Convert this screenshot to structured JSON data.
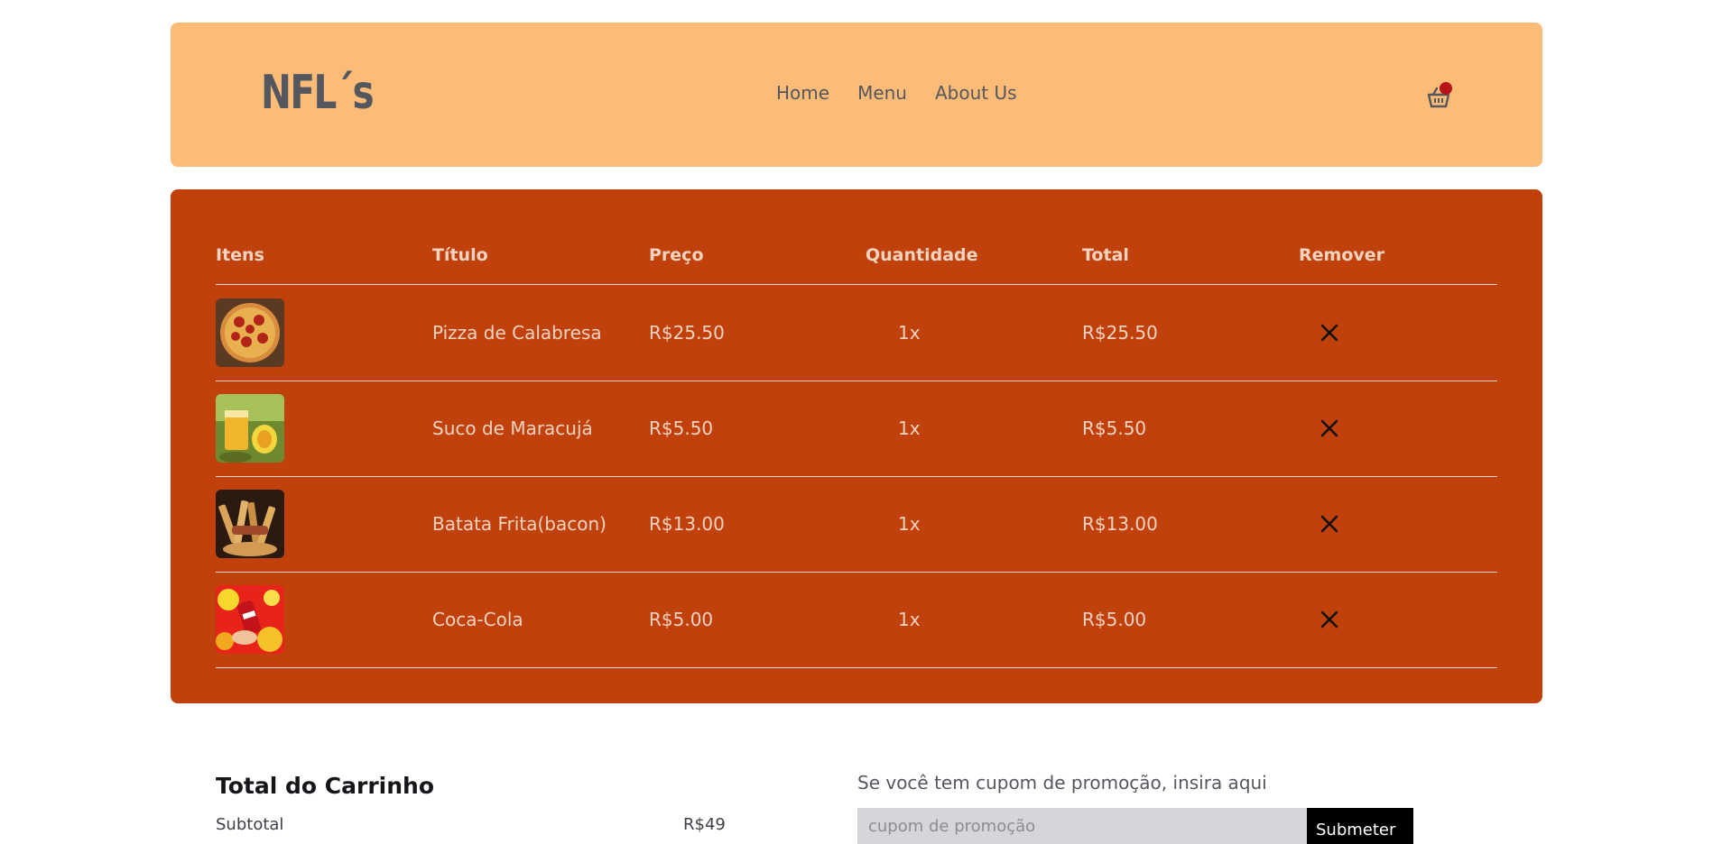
{
  "header": {
    "logo": "NFL´s",
    "nav": [
      "Home",
      "Menu",
      "About Us"
    ],
    "cart_icon": "basket-icon",
    "cart_badge_color": "#b8141c"
  },
  "cart": {
    "columns": [
      "Itens",
      "Título",
      "Preço",
      "Quantidade",
      "Total",
      "Remover"
    ],
    "items": [
      {
        "title": "Pizza de Calabresa",
        "price": "R$25.50",
        "qty": "1x",
        "total": "R$25.50",
        "image": "pizza-image"
      },
      {
        "title": "Suco de Maracujá",
        "price": "R$5.50",
        "qty": "1x",
        "total": "R$5.50",
        "image": "passion-fruit-juice-image"
      },
      {
        "title": "Batata Frita(bacon)",
        "price": "R$13.00",
        "qty": "1x",
        "total": "R$13.00",
        "image": "bacon-fries-image"
      },
      {
        "title": "Coca-Cola",
        "price": "R$5.00",
        "qty": "1x",
        "total": "R$5.00",
        "image": "coca-cola-image"
      }
    ],
    "remove_icon": "close-icon"
  },
  "totals": {
    "title": "Total do Carrinho",
    "subtotal_label": "Subtotal",
    "subtotal_value": "R$49"
  },
  "coupon": {
    "label": "Se você tem cupom de promoção, insira aqui",
    "placeholder": "cupom de promoção",
    "submit": "Submeter"
  },
  "colors": {
    "header_bg": "#fdbb78",
    "panel_bg": "#c1410d",
    "panel_text": "#f4d3c0"
  }
}
